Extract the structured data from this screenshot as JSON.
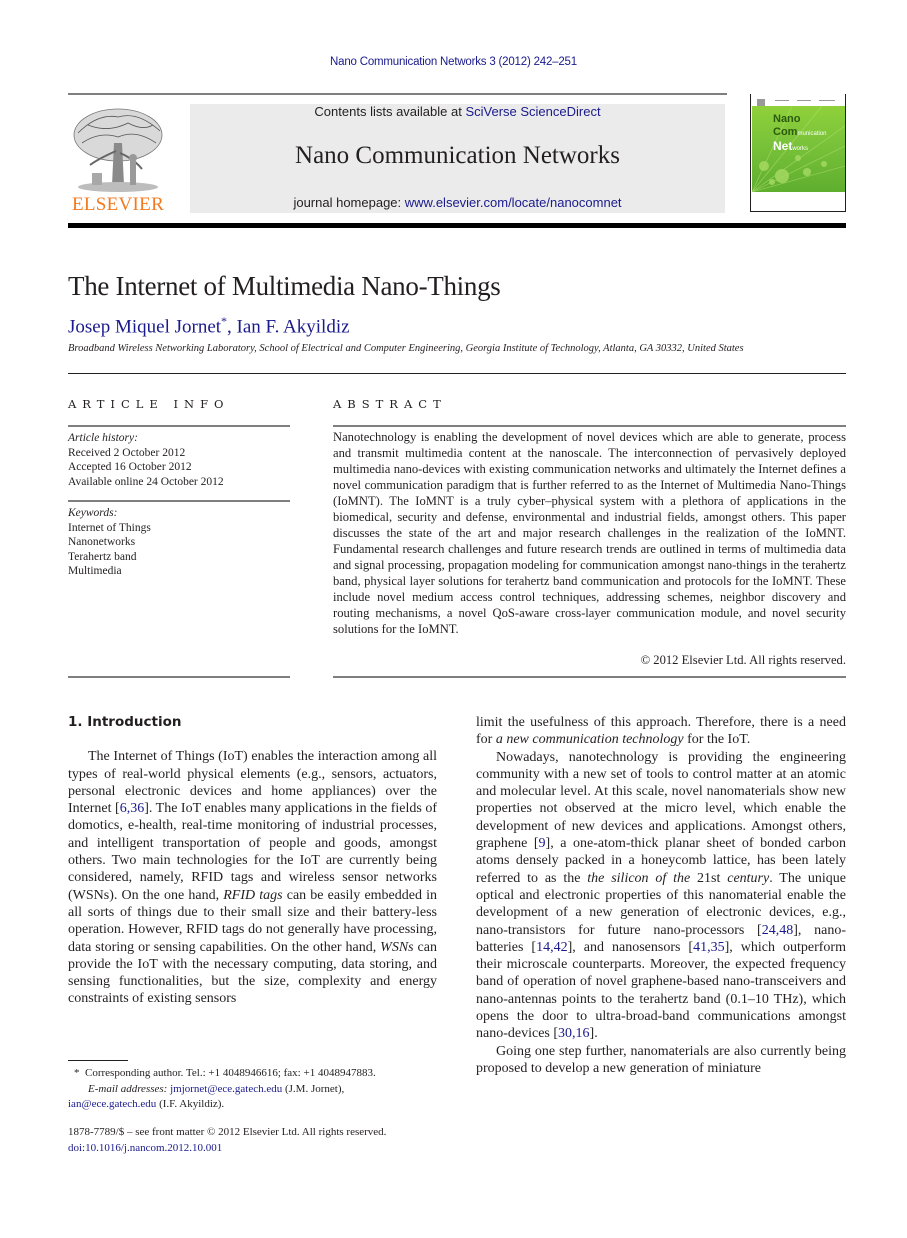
{
  "running_header": "Nano Communication Networks 3 (2012) 242–251",
  "masthead": {
    "publisher_logo_text": "ELSEVIER",
    "contents_prefix": "Contents lists available at ",
    "contents_link": "SciVerse ScienceDirect",
    "journal_name": "Nano Communication Networks",
    "homepage_prefix": "journal homepage: ",
    "homepage_link": "www.elsevier.com/locate/nanocomnet",
    "cover": {
      "line1": "Nano",
      "line2_big": "Com",
      "line2_small": "munication",
      "line3_big": "Net",
      "line3_small": "works"
    },
    "colors": {
      "link": "#1a1a8c",
      "elsevier_orange": "#f47a20",
      "box_gray": "#ebebeb",
      "cover_green": "#79c23a"
    }
  },
  "article": {
    "title": "The Internet of Multimedia Nano-Things",
    "authors": [
      {
        "name": "Josep Miquel Jornet",
        "mark": "*"
      },
      {
        "name": "Ian F. Akyildiz",
        "mark": ""
      }
    ],
    "author_separator": ", ",
    "affiliation": "Broadband Wireless Networking Laboratory, School of Electrical and Computer Engineering, Georgia Institute of Technology, Atlanta, GA 30332, United States"
  },
  "article_info": {
    "heading": "ARTICLE INFO",
    "history_label": "Article history:",
    "history": [
      "Received 2 October 2012",
      "Accepted 16 October 2012",
      "Available online 24 October 2012"
    ],
    "keywords_label": "Keywords:",
    "keywords": [
      "Internet of Things",
      "Nanonetworks",
      "Terahertz band",
      "Multimedia"
    ]
  },
  "abstract": {
    "heading": "ABSTRACT",
    "text": "Nanotechnology is enabling the development of novel devices which are able to generate, process and transmit multimedia content at the nanoscale. The interconnection of pervasively deployed multimedia nano-devices with existing communication networks and ultimately the Internet defines a novel communication paradigm that is further referred to as the Internet of Multimedia Nano-Things (IoMNT). The IoMNT is a truly cyber–physical system with a plethora of applications in the biomedical, security and defense, environmental and industrial fields, amongst others. This paper discusses the state of the art and major research challenges in the realization of the IoMNT. Fundamental research challenges and future research trends are outlined in terms of multimedia data and signal processing, propagation modeling for communication amongst nano-things in the terahertz band, physical layer solutions for terahertz band communication and protocols for the IoMNT. These include novel medium access control techniques, addressing schemes, neighbor discovery and routing mechanisms, a novel QoS-aware cross-layer communication module, and novel security solutions for the IoMNT.",
    "copyright": "© 2012 Elsevier Ltd. All rights reserved."
  },
  "body": {
    "section_heading": "1.  Introduction",
    "p1": {
      "a": "The Internet of Things (IoT) enables the interaction among all types of real-world physical elements (e.g., sensors, actuators, personal electronic devices and home appliances) over the Internet [",
      "ref1": "6,36",
      "b": "]. The IoT enables many applications in the fields of domotics, e-health, real-time monitoring of industrial processes, and intelligent transportation of people and goods, amongst others. Two main technologies for the IoT are currently being considered, namely, RFID tags and wireless sensor networks (WSNs). On the one hand, ",
      "em1": "RFID tags",
      "c": " can be easily embedded in all sorts of things due to their small size and their battery-less operation. However, RFID tags do not generally have processing, data storing or sensing capabilities. On the other hand, ",
      "em2": "WSNs",
      "d": " can provide the IoT with the necessary computing, data storing, and sensing functionalities, but the size, complexity and energy constraints of existing sensors limit the usefulness of this approach. Therefore, there is a need for ",
      "em3": "a new communication technology",
      "e": " for the IoT."
    },
    "p2": {
      "a": "Nowadays, nanotechnology is providing the engineering community with a new set of tools to control matter at an atomic and molecular level. At this scale, novel nanomaterials show new properties not observed at the micro level, which enable the development of new devices and applications. Amongst others, graphene [",
      "ref1": "9",
      "b": "], a one-atom-thick planar sheet of bonded carbon atoms densely packed in a honeycomb lattice, has been lately referred to as the ",
      "em1": "the silicon of the",
      "c": " 21st ",
      "em2": "century",
      "d": ". The unique optical and electronic properties of this nanomaterial enable the development of a new generation of electronic devices, e.g., nano-transistors for future nano-processors [",
      "ref2": "24,48",
      "e": "], nano-batteries [",
      "ref3": "14,42",
      "f": "], and nanosensors [",
      "ref4": "41,35",
      "g": "], which outperform their microscale counterparts. Moreover, the expected frequency band of operation of novel graphene-based nano-transceivers and nano-antennas points to the terahertz band (0.1–10 THz), which opens the door to ultra-broad-band communications amongst nano-devices [",
      "ref5": "30,16",
      "h": "]."
    },
    "p3": "Going one step further, nanomaterials are also currently being proposed to develop a new generation of miniature"
  },
  "footnotes": {
    "star": "*",
    "corresponding": "Corresponding author. Tel.: +1 4048946616; fax: +1 4048947883.",
    "email_label": "E-mail addresses:",
    "email1": "jmjornet@ece.gatech.edu",
    "email1_who": " (J.M. Jornet),",
    "email2": "ian@ece.gatech.edu",
    "email2_who": " (I.F. Akyildiz).",
    "issn": "1878-7789/$ – see front matter © 2012 Elsevier Ltd. All rights reserved.",
    "doi": "doi:10.1016/j.nancom.2012.10.001"
  }
}
